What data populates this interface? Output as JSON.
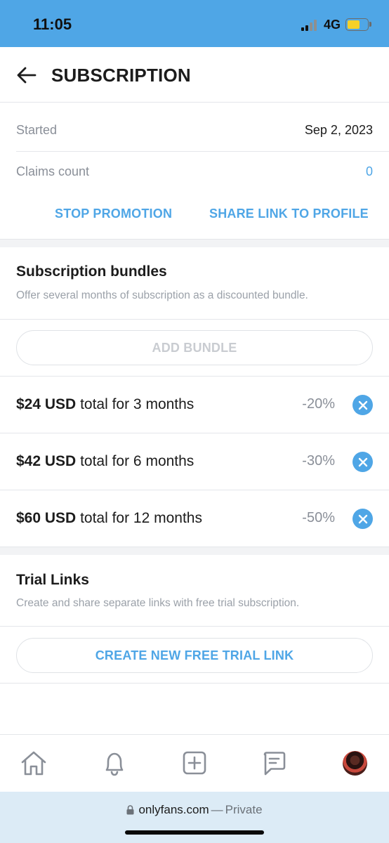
{
  "status_bar": {
    "time": "11:05",
    "network": "4G",
    "battery_level": 0.64,
    "background_color": "#4fa6e6"
  },
  "header": {
    "title": "SUBSCRIPTION",
    "back_icon": "arrow-left-icon"
  },
  "subscription_info": {
    "started_label": "Started",
    "started_value": "Sep 2, 2023",
    "claims_label": "Claims count",
    "claims_value": "0"
  },
  "actions": {
    "stop_promotion": "STOP PROMOTION",
    "share_link": "SHARE LINK TO PROFILE"
  },
  "bundles": {
    "title": "Subscription bundles",
    "description": "Offer several months of subscription as a discounted bundle.",
    "add_button": "ADD BUNDLE",
    "items": [
      {
        "price": "$24 USD",
        "term": "total for 3 months",
        "discount": "-20%"
      },
      {
        "price": "$42 USD",
        "term": "total for 6 months",
        "discount": "-30%"
      },
      {
        "price": "$60 USD",
        "term": "total for 12 months",
        "discount": "-50%"
      }
    ]
  },
  "trial_links": {
    "title": "Trial Links",
    "description": "Create and share separate links with free trial subscription.",
    "create_button": "CREATE NEW FREE TRIAL LINK"
  },
  "bottom_nav": {
    "items": [
      "home-icon",
      "bell-icon",
      "add-post-icon",
      "messages-icon",
      "avatar"
    ]
  },
  "url_bar": {
    "domain": "onlyfans.com",
    "separator": "—",
    "mode": "Private"
  },
  "colors": {
    "accent": "#4fa6e6",
    "muted_text": "#8a8f98",
    "divider": "#e4e6ea"
  }
}
